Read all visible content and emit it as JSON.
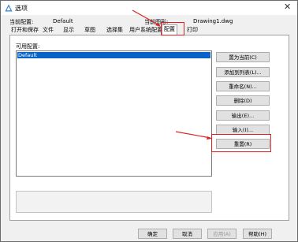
{
  "window": {
    "title": "选项"
  },
  "header": {
    "current_profile_label": "当前配置:",
    "current_profile_value": "Default",
    "current_drawing_label": "当前图形:",
    "current_drawing_value": "Drawing1.dwg"
  },
  "tabs": [
    {
      "label": "打开和保存"
    },
    {
      "label": "文件"
    },
    {
      "label": "显示"
    },
    {
      "label": "草图"
    },
    {
      "label": "选择集"
    },
    {
      "label": "用户系统配置"
    },
    {
      "label": "配置",
      "active": true
    },
    {
      "label": "打印"
    }
  ],
  "profiles": {
    "label": "可用配置:",
    "items": [
      {
        "name": "Default",
        "selected": true
      }
    ]
  },
  "side_buttons": {
    "set_current": "置为当前(C)",
    "add_to_list": "添加到列表(L)...",
    "rename": "重命名(N)...",
    "delete": "删除(D)",
    "export": "输出(E)...",
    "import": "输入(I)...",
    "reset": "重置(R)"
  },
  "footer": {
    "ok": "确定",
    "cancel": "取消",
    "apply": "应用(A)",
    "help": "帮助(H)"
  },
  "colors": {
    "highlight": "#e02020",
    "selection": "#0a64c8"
  },
  "icons": [
    "app-icon",
    "close-icon"
  ]
}
